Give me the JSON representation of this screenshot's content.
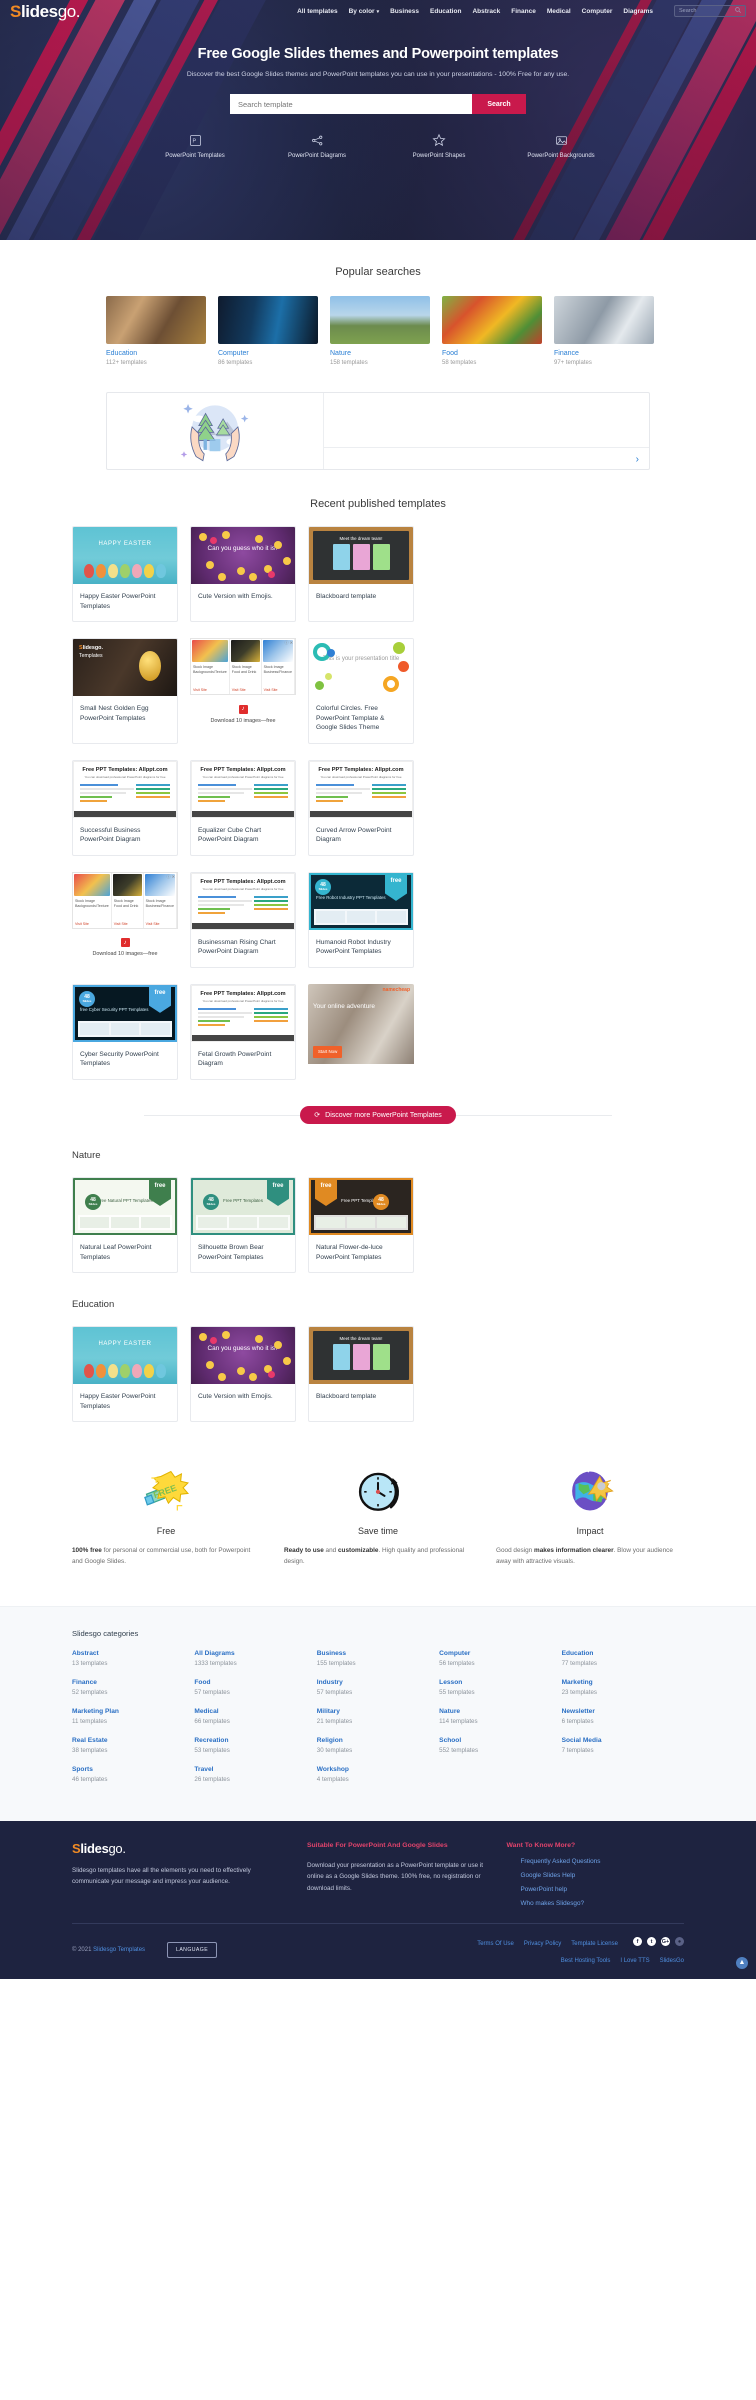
{
  "header": {
    "logo": {
      "s": "S",
      "rest": "lides",
      "go": "go."
    },
    "nav": [
      {
        "label": "All templates",
        "caret": false
      },
      {
        "label": "By color",
        "caret": true
      },
      {
        "label": "Business",
        "caret": false
      },
      {
        "label": "Education",
        "caret": false
      },
      {
        "label": "Abstrack",
        "caret": false
      },
      {
        "label": "Finance",
        "caret": false
      },
      {
        "label": "Medical",
        "caret": false
      },
      {
        "label": "Computer",
        "caret": false
      },
      {
        "label": "Diagrams",
        "caret": false
      }
    ],
    "search_placeholder": "Search"
  },
  "hero": {
    "title": "Free Google Slides themes and Powerpoint templates",
    "subtitle": "Discover the best Google Slides themes and PowerPoint templates you can use in your presentations - 100% Free for any use.",
    "search_placeholder": "Search template",
    "search_button": "Search",
    "quick_links": [
      {
        "label": "PowerPoint Templates",
        "icon": "powerpoint-icon"
      },
      {
        "label": "PowerPoint Diagrams",
        "icon": "diagram-share-icon"
      },
      {
        "label": "PowerPoint Shapes",
        "icon": "star-icon"
      },
      {
        "label": "PowerPoint Backgrounds",
        "icon": "image-icon"
      }
    ]
  },
  "popular": {
    "title": "Popular searches",
    "items": [
      {
        "name": "Education",
        "count": "112+ templates",
        "theme": "t-education"
      },
      {
        "name": "Computer",
        "count": "86 templates",
        "theme": "t-computer"
      },
      {
        "name": "Nature",
        "count": "158 templates",
        "theme": "t-nature"
      },
      {
        "name": "Food",
        "count": "58 templates",
        "theme": "t-food"
      },
      {
        "name": "Finance",
        "count": "97+ templates",
        "theme": "t-finance"
      }
    ]
  },
  "carousel": {
    "next_label": "›",
    "illustration": "hands-holding-trees-illustration"
  },
  "recent": {
    "title": "Recent published templates",
    "rows": [
      [
        {
          "kind": "template",
          "title": "Happy Easter PowerPoint Templates",
          "thumb": "th-easter",
          "thumb_text": "HAPPY EASTER"
        },
        {
          "kind": "template",
          "title": "Cute Version with Emojis.",
          "thumb": "th-emoji",
          "thumb_text": "Can you guess who it is?"
        },
        {
          "kind": "template",
          "title": "Blackboard template",
          "thumb": "th-board",
          "thumb_text": "Meet the dream team!"
        }
      ],
      [
        {
          "kind": "template",
          "title": "Small Nest Golden Egg PowerPoint Templates",
          "thumb": "th-nest",
          "thumb_text": "Slidesgo. Templates"
        },
        {
          "kind": "ad",
          "columns": [
            {
              "caption": "Stock Image Backgrounds/Texture",
              "visit": "Visit Site"
            },
            {
              "caption": "Stock Image Food and Drink",
              "visit": "Visit Site"
            },
            {
              "caption": "Stock Image Business/Finance",
              "visit": "Visit Site"
            }
          ],
          "footer": "Download 10 images—free",
          "logo": "♪"
        },
        {
          "kind": "template",
          "title": "Colorful Circles. Free PowerPoint Template & Google Slides Theme",
          "thumb": "th-circles",
          "thumb_text": "This is your presentation title"
        }
      ],
      [
        {
          "kind": "template",
          "title": "Successful Business PowerPoint Diagram",
          "thumb": "th-allppt",
          "ppt_h1": "Free PPT Templates: Allppt.com",
          "ppt_h2": "You can download professional PowerPoint diagrams for free"
        },
        {
          "kind": "template",
          "title": "Equalizer Cube Chart PowerPoint Diagram",
          "thumb": "th-allppt",
          "ppt_h1": "Free PPT Templates: Allppt.com",
          "ppt_h2": "You can download professional PowerPoint diagrams for free"
        },
        {
          "kind": "template",
          "title": "Curved Arrow PowerPoint Diagram",
          "thumb": "th-allppt",
          "ppt_h1": "Free PPT Templates: Allppt.com",
          "ppt_h2": "You can download professional PowerPoint diagrams for free"
        }
      ],
      [
        {
          "kind": "ad",
          "columns": [
            {
              "caption": "Stock Image Backgrounds/Texture",
              "visit": "Visit Site"
            },
            {
              "caption": "Stock Image Food and Drink",
              "visit": "Visit Site"
            },
            {
              "caption": "Stock Image Business/Finance",
              "visit": "Visit Site"
            }
          ],
          "footer": "Download 10 images—free",
          "logo": "♪"
        },
        {
          "kind": "template",
          "title": "Businessman Rising Chart PowerPoint Diagram",
          "thumb": "th-allppt",
          "ppt_h1": "Free PPT Templates: Allppt.com",
          "ppt_h2": "You can download professional PowerPoint diagrams for free"
        },
        {
          "kind": "template",
          "title": "Humanoid Robot Industry PowerPoint Templates",
          "thumb": "th-robot",
          "badge_free": "free",
          "badge_slides": "48",
          "badge_slides_sub": "Slides",
          "thumb_text": "Free Robot Industry PPT Templates"
        }
      ],
      [
        {
          "kind": "template",
          "title": "Cyber Security PowerPoint Templates",
          "thumb": "th-cyber",
          "badge_free": "free",
          "badge_slides": "48",
          "badge_slides_sub": "Slides",
          "thumb_text": "free Cyber Security PPT Templates"
        },
        {
          "kind": "template",
          "title": "Fetal Growth PowerPoint Diagram",
          "thumb": "th-allppt",
          "ppt_h1": "Free PPT Templates: Allppt.com",
          "ppt_h2": "You can download professional PowerPoint diagrams for free"
        },
        {
          "kind": "ad_banner",
          "title": "Your online adventure",
          "cta": "Start Now",
          "brand": "namecheap"
        }
      ]
    ],
    "discover_button": "Discover more PowerPoint Templates",
    "discover_icon": "refresh-icon"
  },
  "nature": {
    "title": "Nature",
    "cards": [
      {
        "title": "Natural Leaf PowerPoint Templates",
        "thumb": "th-leaf",
        "badge_free": "free",
        "badge_slides": "48",
        "badge_slides_sub": "Slides",
        "thumb_text": "Free Natural PPT Templates"
      },
      {
        "title": "Silhouette Brown Bear PowerPoint Templates",
        "thumb": "th-bear",
        "badge_free": "free",
        "badge_slides": "48",
        "badge_slides_sub": "Slides",
        "thumb_text": "Free PPT Templates"
      },
      {
        "title": "Natural Flower-de-luce PowerPoint Templates",
        "thumb": "th-flower",
        "badge_free": "free",
        "badge_slides": "48",
        "badge_slides_sub": "Slides",
        "thumb_text": "Free PPT Templates"
      }
    ]
  },
  "education": {
    "title": "Education",
    "cards": [
      {
        "title": "Happy Easter PowerPoint Templates",
        "thumb": "th-easter",
        "thumb_text": "HAPPY EASTER"
      },
      {
        "title": "Cute Version with Emojis.",
        "thumb": "th-emoji",
        "thumb_text": "Can you guess who it is?"
      },
      {
        "title": "Blackboard template",
        "thumb": "th-board",
        "thumb_text": "Meet the dream team!"
      }
    ]
  },
  "features": [
    {
      "icon": "megaphone-free-icon",
      "title": "Free",
      "desc_parts": [
        {
          "b": true,
          "t": "100% free"
        },
        {
          "b": false,
          "t": " for personal or commercial use, both for Powerpoint and Google Slides."
        }
      ]
    },
    {
      "icon": "clock-icon",
      "title": "Save time",
      "desc_parts": [
        {
          "b": true,
          "t": "Ready to use"
        },
        {
          "b": false,
          "t": " and "
        },
        {
          "b": true,
          "t": "customizable"
        },
        {
          "b": false,
          "t": ". High quality and professional design."
        }
      ]
    },
    {
      "icon": "globe-impact-icon",
      "title": "Impact",
      "desc_parts": [
        {
          "b": false,
          "t": "Good design "
        },
        {
          "b": true,
          "t": "makes information clearer"
        },
        {
          "b": false,
          "t": ". Blow your audience away with attractive visuals."
        }
      ]
    }
  ],
  "categories": {
    "title": "Slidesgo categories",
    "items": [
      {
        "name": "Abstract",
        "count": "13 templates"
      },
      {
        "name": "All Diagrams",
        "count": "1333 templates"
      },
      {
        "name": "Business",
        "count": "155 templates"
      },
      {
        "name": "Computer",
        "count": "56 templates"
      },
      {
        "name": "Education",
        "count": "77 templates"
      },
      {
        "name": "Finance",
        "count": "52 templates"
      },
      {
        "name": "Food",
        "count": "57 templates"
      },
      {
        "name": "Industry",
        "count": "57 templates"
      },
      {
        "name": "Lesson",
        "count": "55 templates"
      },
      {
        "name": "Marketing",
        "count": "23 templates"
      },
      {
        "name": "Marketing Plan",
        "count": "11 templates"
      },
      {
        "name": "Medical",
        "count": "66 templates"
      },
      {
        "name": "Military",
        "count": "21 templates"
      },
      {
        "name": "Nature",
        "count": "114 templates"
      },
      {
        "name": "Newsletter",
        "count": "6 templates"
      },
      {
        "name": "Real Estate",
        "count": "38 templates"
      },
      {
        "name": "Recreation",
        "count": "53 templates"
      },
      {
        "name": "Religion",
        "count": "30 templates"
      },
      {
        "name": "School",
        "count": "552 templates"
      },
      {
        "name": "Social Media",
        "count": "7 templates"
      },
      {
        "name": "Sports",
        "count": "46 templates"
      },
      {
        "name": "Travel",
        "count": "26 templates"
      },
      {
        "name": "Workshop",
        "count": "4 templates"
      }
    ]
  },
  "footer": {
    "logo": {
      "s": "S",
      "rest": "lides",
      "go": "go."
    },
    "about": "Slidesgo templates have all the elements you need to effectively communicate your message and impress your audience.",
    "col2_head": "Suitable For PowerPoint And Google Slides",
    "col2_text": "Download your presentation as a PowerPoint template or use it online as a Google Slides theme. 100% free, no registration or download limits.",
    "col3_head": "Want To Know More?",
    "col3_links": [
      "Frequently Asked Questions",
      "Google Slides Help",
      "PowerPoint help",
      "Who makes Slidesgo?"
    ],
    "copyright_pre": "© 2021 ",
    "copyright_link": "Slidesgo Templates",
    "language_button": "LANGUAGE",
    "bottom_links_row1": [
      "Terms Of Use",
      "Privacy Policy",
      "Template License"
    ],
    "bottom_links_row2": [
      "Best Hosting Tools",
      "I Love TTS",
      "SlidesGo"
    ],
    "socials": [
      {
        "name": "facebook-icon",
        "glyph": "f",
        "cls": "fb"
      },
      {
        "name": "twitter-icon",
        "glyph": "t",
        "cls": "tw"
      },
      {
        "name": "google-plus-icon",
        "glyph": "G+",
        "cls": "gp"
      },
      {
        "name": "rss-icon",
        "glyph": "●",
        "cls": "rs"
      }
    ],
    "scroll_top_icon": "▲"
  }
}
